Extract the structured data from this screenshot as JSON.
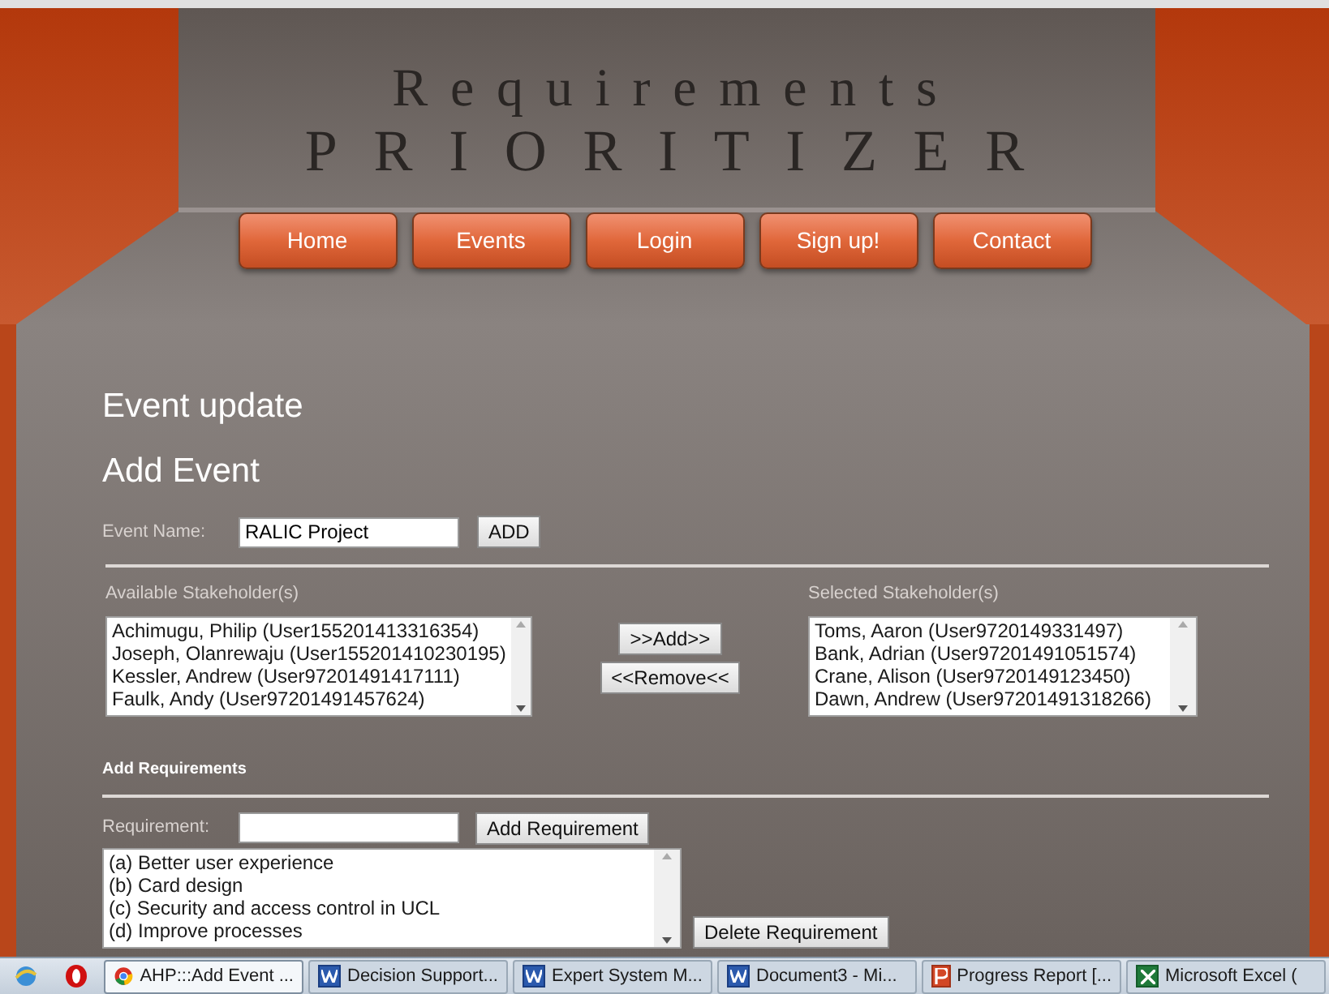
{
  "header": {
    "title_top": "Requirements",
    "title_bottom": "PRIORITIZER"
  },
  "nav": [
    {
      "label": "Home"
    },
    {
      "label": "Events"
    },
    {
      "label": "Login"
    },
    {
      "label": "Sign up!"
    },
    {
      "label": "Contact"
    }
  ],
  "page": {
    "heading": "Event update",
    "subheading": "Add Event"
  },
  "event_form": {
    "label": "Event Name:",
    "value": "RALIC Project",
    "button": "ADD"
  },
  "available": {
    "label": "Available Stakeholder(s)",
    "items": [
      "Achimugu, Philip (User155201413316354)",
      "Joseph, Olanrewaju (User155201410230195)",
      "Kessler, Andrew (User97201491417111)",
      "Faulk, Andy (User97201491457624)"
    ]
  },
  "transfer_buttons": [
    ">>Add>>",
    "<<Remove<<"
  ],
  "selected": {
    "label": "Selected Stakeholder(s)",
    "items": [
      "Toms, Aaron (User9720149331497)",
      "Bank, Adrian (User97201491051574)",
      "Crane, Alison (User9720149123450)",
      "Dawn, Andrew (User97201491318266)"
    ]
  },
  "requirements": {
    "heading": "Add Requirements",
    "label": "Requirement:",
    "button": "Add Requirement",
    "items": [
      "(a) Better user experience",
      "(b) Card design",
      "(c) Security and access control in UCL",
      "(d) Improve processes"
    ],
    "delete_button": "Delete Requirement"
  },
  "taskbar": {
    "pinned": [
      {
        "kind": "ie"
      },
      {
        "kind": "opera"
      }
    ],
    "tasks": [
      {
        "kind": "chrome",
        "label": "AHP:::Add Event ...",
        "selected": true
      },
      {
        "kind": "word",
        "label": "Decision Support...",
        "selected": false
      },
      {
        "kind": "word",
        "label": "Expert System M...",
        "selected": false
      },
      {
        "kind": "word",
        "label": "Document3 - Mi...",
        "selected": false
      },
      {
        "kind": "powerpoint",
        "label": "Progress Report [...",
        "selected": false
      },
      {
        "kind": "excel",
        "label": "Microsoft Excel (",
        "selected": false
      }
    ]
  }
}
